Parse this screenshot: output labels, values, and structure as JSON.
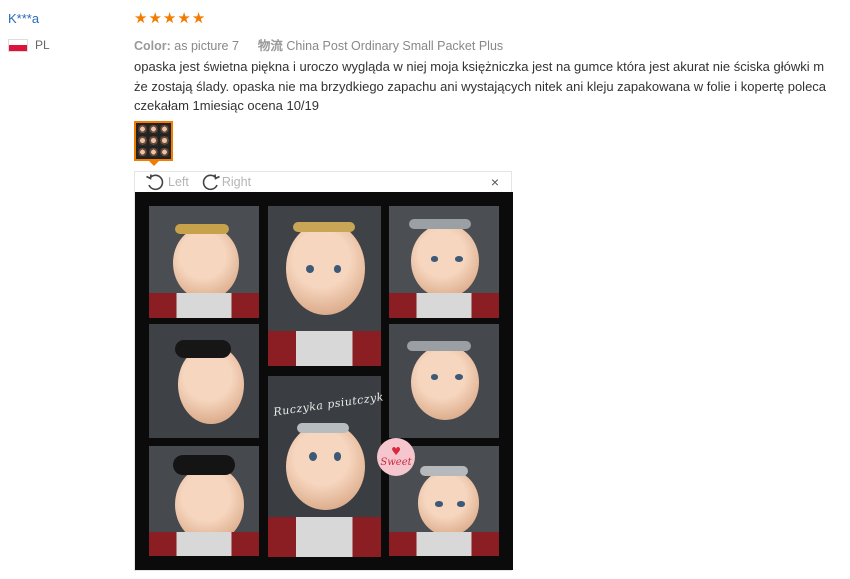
{
  "reviewer": {
    "name": "K***a",
    "country_code": "PL"
  },
  "rating": {
    "stars": 5,
    "max": 5
  },
  "attributes": {
    "color_label": "Color:",
    "color_value": "as picture 7",
    "shipping_label": "物流",
    "shipping_value": "China Post Ordinary Small Packet Plus"
  },
  "review": {
    "lines": [
      "opaska jest świetna piękna i uroczo wygląda w niej moja księżniczka jest na gumce która jest akurat nie ściska główki m",
      "że zostają ślady. opaska nie ma brzydkiego zapachu ani wystających nitek ani kleju zapakowana w folie i kopertę poleca",
      "czekałam 1miesiąc ocena 10/19"
    ]
  },
  "viewer": {
    "rotate_left_label": "Left",
    "rotate_right_label": "Right",
    "close_symbol": "×",
    "watermark_text": "Ruczyka psiutczyk",
    "sticker_text": "Sweet"
  },
  "colors": {
    "accent": "#f27c00",
    "link": "#2a6ab8"
  }
}
